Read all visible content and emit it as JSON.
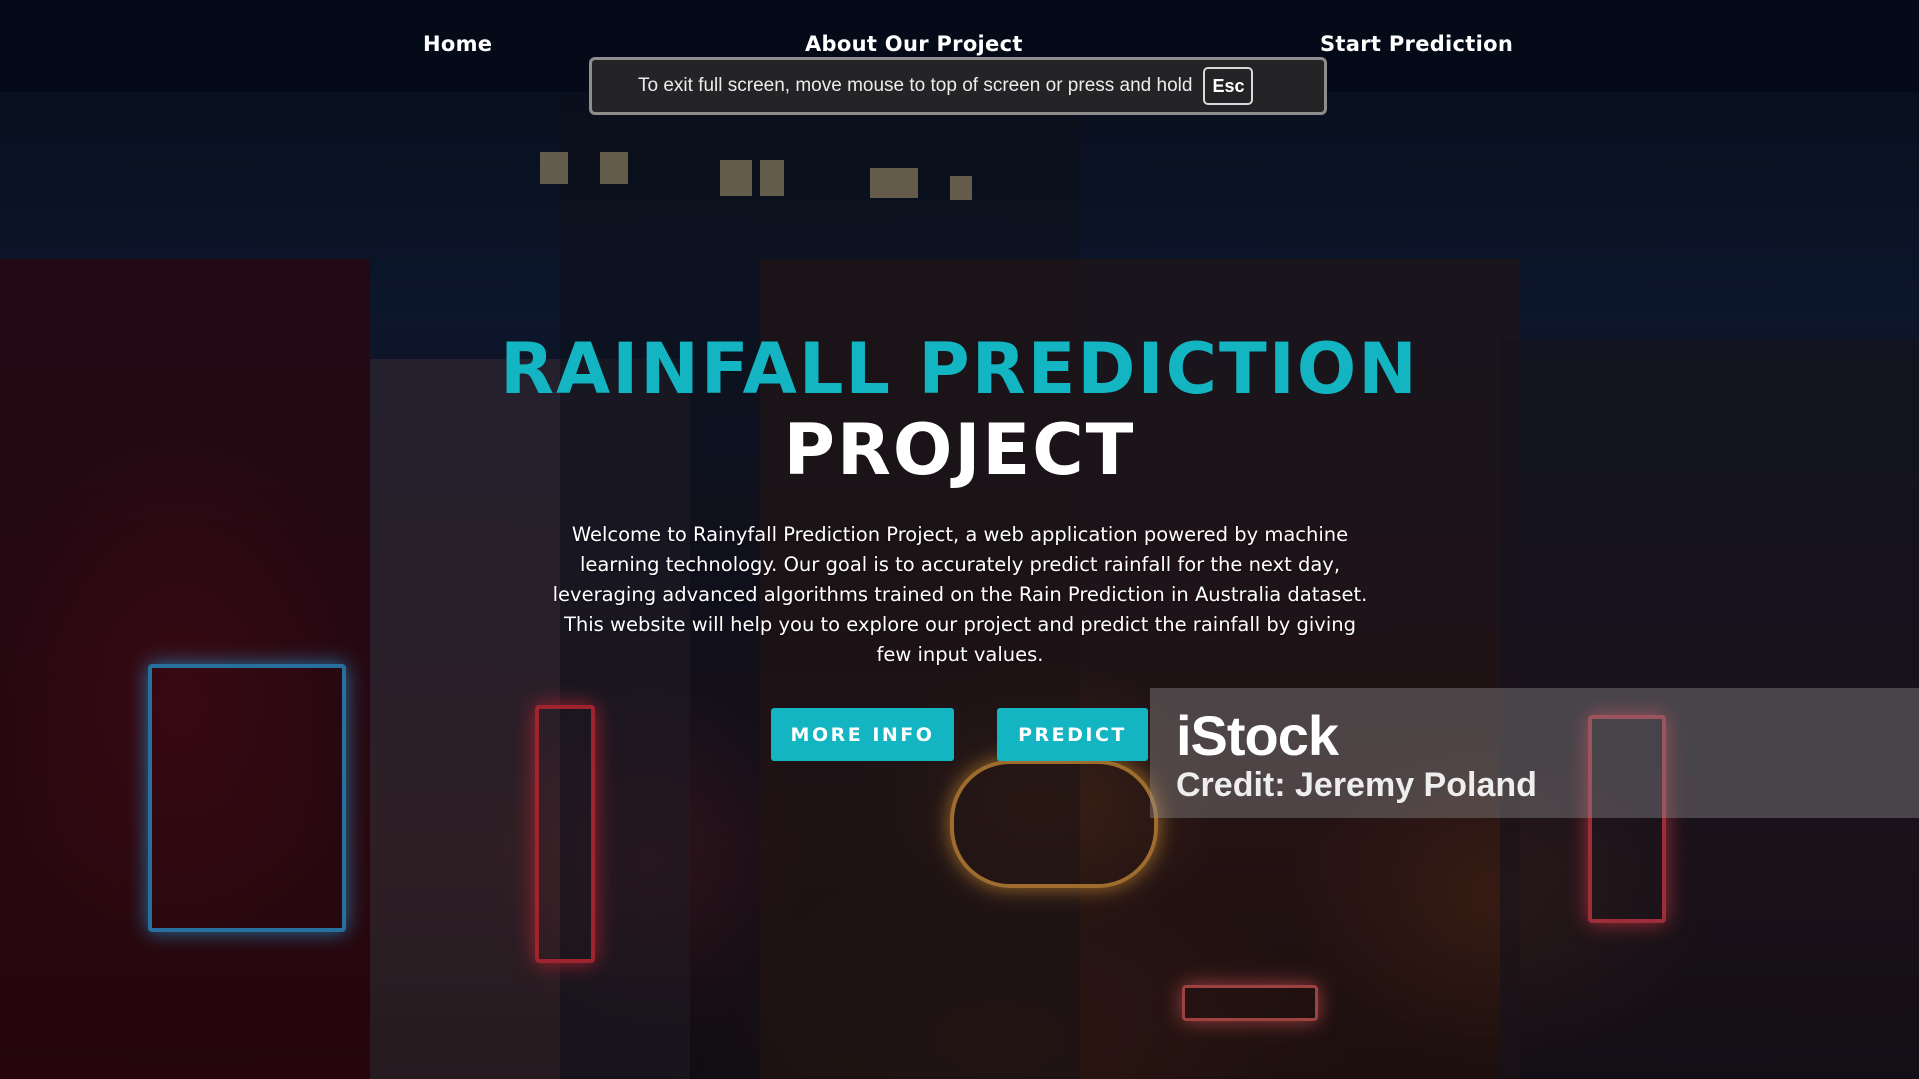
{
  "nav": {
    "home": "Home",
    "about": "About Our Project",
    "start": "Start Prediction"
  },
  "fullscreen_notice": {
    "message": "To exit full screen, move mouse to top of screen or press and hold",
    "key": "Esc"
  },
  "hero": {
    "title_line1": "RAINFALL PREDICTION",
    "title_line2": "PROJECT",
    "description": "Welcome to Rainyfall Prediction Project, a web application powered by machine learning technology. Our goal is to accurately predict rainfall for the next day, leveraging advanced algorithms trained on the Rain Prediction in Australia dataset. This website will help you to explore our project and predict the rainfall by giving few input values.",
    "more_info_label": "MORE INFO",
    "predict_label": "PREDICT"
  },
  "watermark": {
    "logo": "iStock",
    "credit": "Credit: Jeremy Poland"
  },
  "colors": {
    "accent": "#12b5c1",
    "nav_bg": "#040a19",
    "text": "#ffffff"
  }
}
